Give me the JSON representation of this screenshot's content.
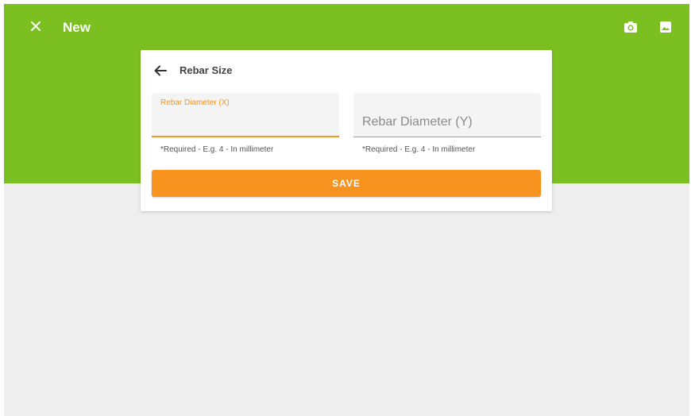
{
  "app_bar": {
    "title": "New",
    "background_color": "#7cbf21",
    "icons": {
      "close": "close-icon",
      "camera": "camera-icon",
      "image": "image-icon"
    }
  },
  "dialog": {
    "title": "Rebar Size",
    "back_icon": "arrow-left-icon",
    "fields": [
      {
        "label": "Rebar Diameter (X)",
        "value": "",
        "helper": "*Required - E.g. 4 - In millimeter",
        "focused": true
      },
      {
        "placeholder": "Rebar Diameter (Y)",
        "value": "",
        "helper": "*Required - E.g. 4 - In millimeter",
        "focused": false
      }
    ],
    "save_label": "SAVE",
    "accent_color": "#f7931e"
  }
}
